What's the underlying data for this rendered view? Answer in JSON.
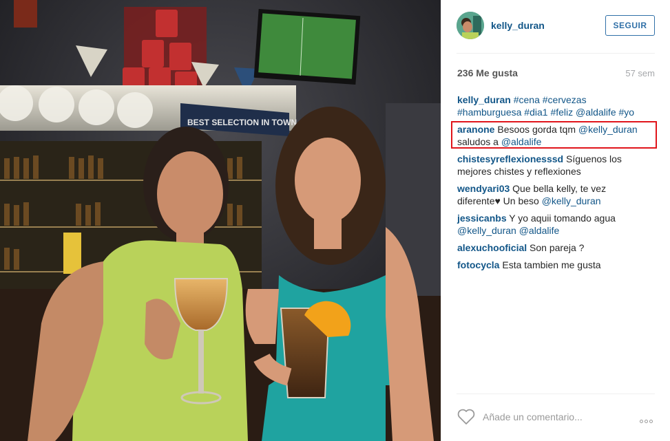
{
  "post": {
    "username": "kelly_duran",
    "follow_label": "SEGUIR",
    "likes": "236 Me gusta",
    "age": "57 sem",
    "comment_placeholder": "Añade un comentario...",
    "photo_sign": "BEST SELECTION IN TOWN"
  },
  "comments": [
    {
      "user": "kelly_duran",
      "parts": [
        {
          "text": "#cena",
          "link": true
        },
        {
          "text": " "
        },
        {
          "text": "#cervezas",
          "link": true
        },
        {
          "text": " "
        },
        {
          "text": "#hamburguesa",
          "link": true
        },
        {
          "text": " "
        },
        {
          "text": "#dia1",
          "link": true
        },
        {
          "text": " "
        },
        {
          "text": "#feliz",
          "link": true
        },
        {
          "text": " "
        },
        {
          "text": "@aldalife",
          "link": true
        },
        {
          "text": " "
        },
        {
          "text": "#yo",
          "link": true
        }
      ]
    },
    {
      "user": "aranone",
      "parts": [
        {
          "text": "Besoos gorda tqm "
        },
        {
          "text": "@kelly_duran",
          "link": true
        },
        {
          "text": " saludos a "
        },
        {
          "text": "@aldalife",
          "link": true
        }
      ]
    },
    {
      "user": "chistesyreflexionesssd",
      "parts": [
        {
          "text": "Síguenos los mejores chistes y reflexiones"
        }
      ]
    },
    {
      "user": "wendyari03",
      "parts": [
        {
          "text": "Que bella kelly, te vez diferente♥ Un beso "
        },
        {
          "text": "@kelly_duran",
          "link": true
        }
      ]
    },
    {
      "user": "jessicanbs",
      "parts": [
        {
          "text": "Y yo aquii tomando agua "
        },
        {
          "text": "@kelly_duran",
          "link": true
        },
        {
          "text": " "
        },
        {
          "text": "@aldalife",
          "link": true
        }
      ]
    },
    {
      "user": "alexuchooficial",
      "parts": [
        {
          "text": "Son pareja ?"
        }
      ]
    },
    {
      "user": "fotocycla",
      "parts": [
        {
          "text": "Esta tambien me gusta"
        }
      ]
    }
  ],
  "icons": {
    "like": "heart-outline-icon",
    "more": "more-options-icon"
  },
  "colors": {
    "link": "#125688",
    "follow": "#2f6fa7",
    "highlight": "#e0141a"
  }
}
